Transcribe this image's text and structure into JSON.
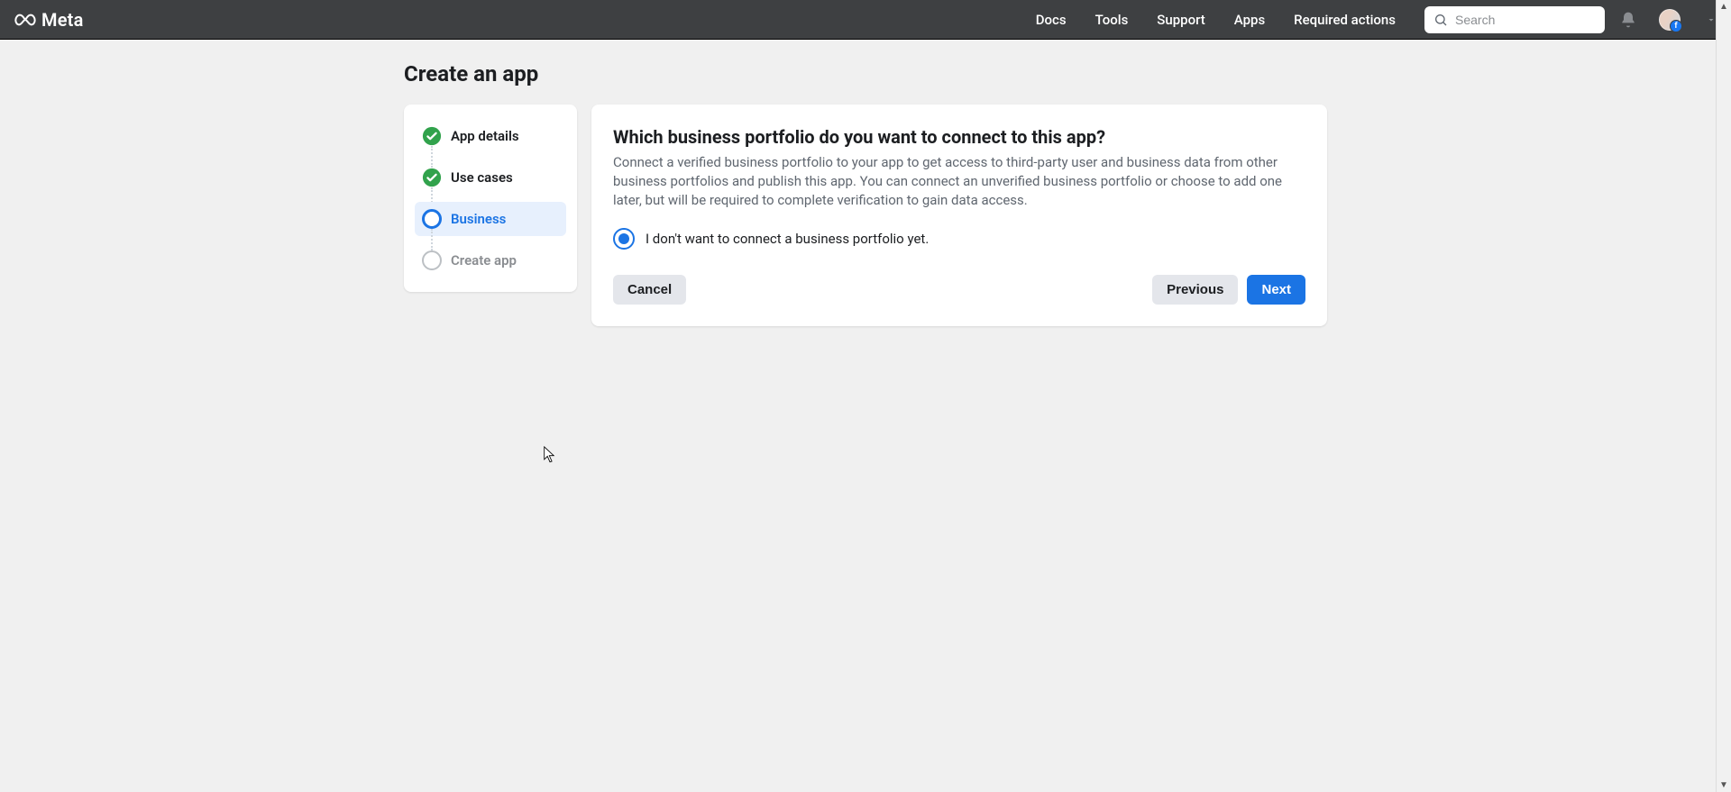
{
  "brand": "Meta",
  "nav": {
    "docs": "Docs",
    "tools": "Tools",
    "support": "Support",
    "apps": "Apps",
    "required": "Required actions"
  },
  "search": {
    "placeholder": "Search"
  },
  "page": {
    "title": "Create an app"
  },
  "steps": [
    {
      "label": "App details",
      "state": "complete"
    },
    {
      "label": "Use cases",
      "state": "complete"
    },
    {
      "label": "Business",
      "state": "current"
    },
    {
      "label": "Create app",
      "state": "upcoming"
    }
  ],
  "main": {
    "heading": "Which business portfolio do you want to connect to this app?",
    "description": "Connect a verified business portfolio to your app to get access to third-party user and business data from other business portfolios and publish this app. You can connect an unverified business portfolio or choose to add one later, but will be required to complete verification to gain data access.",
    "option": "I don't want to connect a business portfolio yet."
  },
  "actions": {
    "cancel": "Cancel",
    "previous": "Previous",
    "next": "Next"
  }
}
